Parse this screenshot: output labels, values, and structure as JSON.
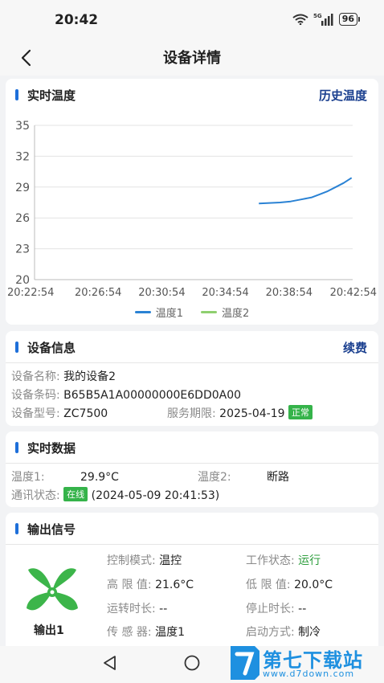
{
  "status_bar": {
    "time": "20:42",
    "network": "5G",
    "battery": "96"
  },
  "nav": {
    "title": "设备详情"
  },
  "temp_card": {
    "title": "实时温度",
    "action": "历史温度"
  },
  "chart_data": {
    "type": "line",
    "x": [
      "20:22:54",
      "20:26:54",
      "20:30:54",
      "20:34:54",
      "20:38:54",
      "20:42:54"
    ],
    "ylim": [
      20,
      35
    ],
    "yticks": [
      "35",
      "32",
      "29",
      "26",
      "23",
      "20"
    ],
    "series": [
      {
        "name": "温度1",
        "color": "#2a82d4",
        "points": [
          [
            "20:37:00",
            27.4
          ],
          [
            "20:37:40",
            27.45
          ],
          [
            "20:38:20",
            27.5
          ],
          [
            "20:39:00",
            27.6
          ],
          [
            "20:39:40",
            27.8
          ],
          [
            "20:40:20",
            28.0
          ],
          [
            "20:40:50",
            28.3
          ],
          [
            "20:41:20",
            28.6
          ],
          [
            "20:41:50",
            29.0
          ],
          [
            "20:42:20",
            29.4
          ],
          [
            "20:42:50",
            29.9
          ]
        ]
      },
      {
        "name": "温度2",
        "color": "#8fcf6f",
        "points": []
      }
    ],
    "grid": true,
    "legend": "bottom"
  },
  "device_info": {
    "title": "设备信息",
    "action": "续费",
    "name_label": "设备名称:",
    "name_value": "我的设备2",
    "code_label": "设备条码:",
    "code_value": "B65B5A1A00000000E6DD0A00",
    "model_label": "设备型号:",
    "model_value": "ZC7500",
    "service_label": "服务期限:",
    "service_value": "2025-04-19",
    "service_status": "正常"
  },
  "realtime": {
    "title": "实时数据",
    "temp1_label": "温度1:",
    "temp1_value": "29.9°C",
    "temp2_label": "温度2:",
    "temp2_value": "断路",
    "comm_label": "通讯状态:",
    "comm_status": "在线",
    "comm_time": "(2024-05-09 20:41:53)"
  },
  "output": {
    "title": "输出信号",
    "fan_label": "输出1",
    "mode_label": "控制模式:",
    "mode_value": "温控",
    "work_label": "工作状态:",
    "work_value": "运行",
    "high_label": "高 限 值:",
    "high_value": "21.6°C",
    "low_label": "低 限 值:",
    "low_value": "20.0°C",
    "run_label": "运转时长:",
    "run_value": "--",
    "stop_label": "停止时长:",
    "stop_value": "--",
    "sensor_label": "传 感 器:",
    "sensor_value": "温度1",
    "start_label": "启动方式:",
    "start_value": "制冷"
  },
  "watermark": {
    "text": "第七下载站",
    "url": "www.d7down.com"
  },
  "colors": {
    "accent": "#1e6fd9",
    "link": "#1a3f8f",
    "ok": "#35b34a",
    "fan": "#3cb54a"
  }
}
